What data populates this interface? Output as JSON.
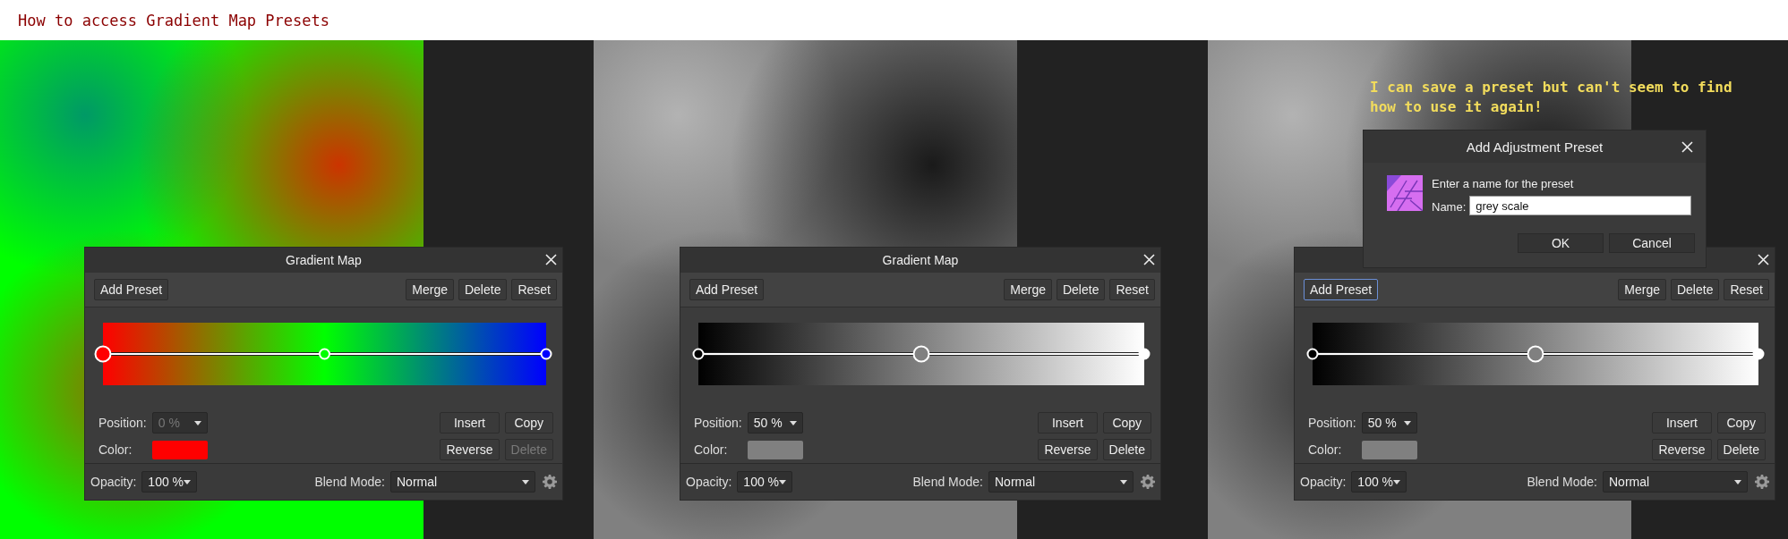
{
  "page_title": "How to access Gradient Map Presets",
  "screens": [
    {
      "panel": {
        "title": "Gradient Map",
        "toolbar": [
          {
            "label": "Add Preset",
            "focused": false
          },
          {
            "label": "Merge",
            "focused": false
          },
          {
            "label": "Delete",
            "focused": false
          },
          {
            "label": "Reset",
            "focused": false
          }
        ],
        "stops": [
          {
            "color": "#ff0000",
            "level": 0,
            "selected": true
          },
          {
            "color": "#00ff00",
            "level": 0.5,
            "selected": false
          },
          {
            "color": "#0000ff",
            "level": 1,
            "selected": false
          }
        ],
        "position_label": "Position:",
        "position": {
          "value": "0 %",
          "disabled": true
        },
        "color_label": "Color:",
        "actions": [
          {
            "label": "Insert",
            "disabled": false
          },
          {
            "label": "Copy",
            "disabled": false
          },
          {
            "label": "Reverse",
            "disabled": false
          },
          {
            "label": "Delete",
            "disabled": true
          }
        ],
        "opacity_label": "Opacity:",
        "opacity": "100 %",
        "blend_label": "Blend Mode:",
        "blend_mode": "Normal"
      }
    },
    {
      "panel": {
        "title": "Gradient Map",
        "toolbar": [
          {
            "label": "Add Preset",
            "focused": false
          },
          {
            "label": "Merge",
            "focused": false
          },
          {
            "label": "Delete",
            "focused": false
          },
          {
            "label": "Reset",
            "focused": false
          }
        ],
        "stops": [
          {
            "color": "#000000",
            "level": 0,
            "selected": false
          },
          {
            "color": "#808080",
            "level": 0.5,
            "selected": true
          },
          {
            "color": "#ffffff",
            "level": 1,
            "selected": false
          }
        ],
        "position_label": "Position:",
        "position": {
          "value": "50 %",
          "disabled": false
        },
        "color_label": "Color:",
        "actions": [
          {
            "label": "Insert",
            "disabled": false
          },
          {
            "label": "Copy",
            "disabled": false
          },
          {
            "label": "Reverse",
            "disabled": false
          },
          {
            "label": "Delete",
            "disabled": false
          }
        ],
        "opacity_label": "Opacity:",
        "opacity": "100 %",
        "blend_label": "Blend Mode:",
        "blend_mode": "Normal"
      }
    },
    {
      "note": "I can save a preset but can't seem to find how to use it again!",
      "dialog": {
        "title": "Add Adjustment Preset",
        "prompt": "Enter a name for the preset",
        "field_label": "Name:",
        "value": "grey scale",
        "buttons": [
          "OK",
          "Cancel"
        ]
      },
      "panel": {
        "toolbar": [
          {
            "label": "Add Preset",
            "focused": true
          },
          {
            "label": "Merge",
            "focused": false
          },
          {
            "label": "Delete",
            "focused": false
          },
          {
            "label": "Reset",
            "focused": false
          }
        ],
        "stops": [
          {
            "color": "#000000",
            "level": 0,
            "selected": false
          },
          {
            "color": "#808080",
            "level": 0.5,
            "selected": true
          },
          {
            "color": "#ffffff",
            "level": 1,
            "selected": false
          }
        ],
        "position_label": "Position:",
        "position": {
          "value": "50 %",
          "disabled": false
        },
        "color_label": "Color:",
        "actions": [
          {
            "label": "Insert",
            "disabled": false
          },
          {
            "label": "Copy",
            "disabled": false
          },
          {
            "label": "Reverse",
            "disabled": false
          },
          {
            "label": "Delete",
            "disabled": false
          }
        ],
        "opacity_label": "Opacity:",
        "opacity": "100 %",
        "blend_label": "Blend Mode:",
        "blend_mode": "Normal"
      }
    }
  ]
}
